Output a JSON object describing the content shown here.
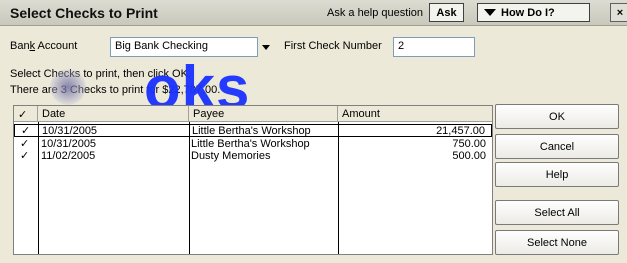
{
  "titlebar": {
    "title": "Select Checks to Print",
    "help_question": "Ask a help question",
    "ask_label": "Ask",
    "how_do_i_label": "How Do I?",
    "close_glyph": "×"
  },
  "form": {
    "bank_account_label": "Bank Account",
    "bank_account_value": "Big Bank Checking",
    "first_check_label": "First Check Number",
    "first_check_value": "2"
  },
  "instructions": {
    "line1": "Select Checks to print, then click OK.",
    "line2": "There are 3 Checks to print for $22,707.00."
  },
  "watermark": {
    "text": "oks"
  },
  "table": {
    "columns": [
      "✓",
      "Date",
      "Payee",
      "Amount"
    ],
    "rows": [
      {
        "check": "✓",
        "date": "10/31/2005",
        "payee": "Little Bertha's Workshop",
        "amount": "21,457.00",
        "selected": true
      },
      {
        "check": "✓",
        "date": "10/31/2005",
        "payee": "Little Bertha's Workshop",
        "amount": "750.00",
        "selected": false
      },
      {
        "check": "✓",
        "date": "11/02/2005",
        "payee": "Dusty Memories",
        "amount": "500.00",
        "selected": false
      }
    ]
  },
  "buttons": {
    "ok": "OK",
    "cancel": "Cancel",
    "help": "Help",
    "select_all": "Select All",
    "select_none": "Select None"
  }
}
